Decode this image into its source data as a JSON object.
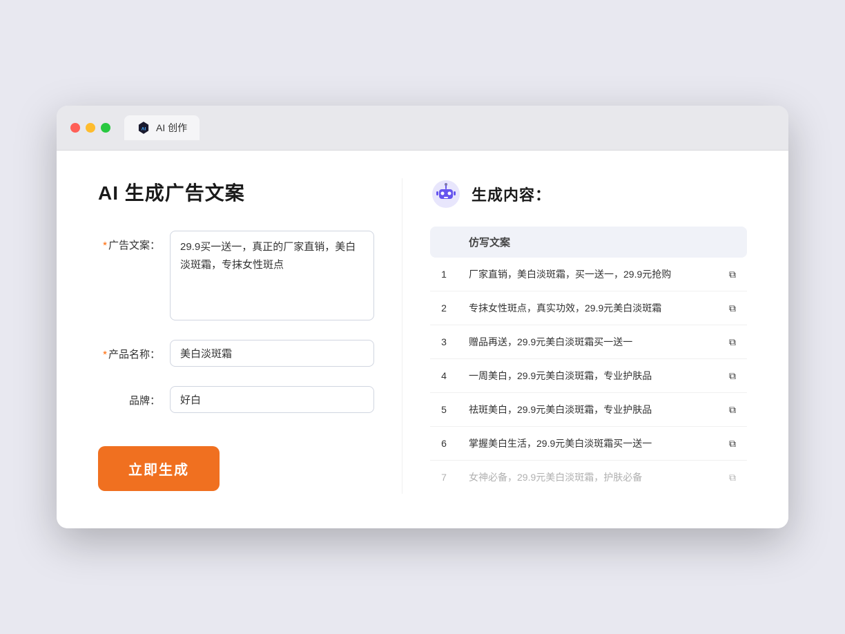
{
  "window": {
    "tab_label": "AI 创作"
  },
  "left": {
    "title": "AI 生成广告文案",
    "fields": [
      {
        "label": "广告文案：",
        "required": true,
        "type": "textarea",
        "value": "29.9买一送一，真正的厂家直销，美白淡斑霜，专抹女性斑点",
        "name": "ad-copy-textarea"
      },
      {
        "label": "产品名称：",
        "required": true,
        "type": "input",
        "value": "美白淡斑霜",
        "name": "product-name-input"
      },
      {
        "label": "品牌：",
        "required": false,
        "type": "input",
        "value": "好白",
        "name": "brand-input"
      }
    ],
    "button_label": "立即生成"
  },
  "right": {
    "title": "生成内容：",
    "table": {
      "header": "仿写文案",
      "rows": [
        {
          "num": "1",
          "text": "厂家直销，美白淡斑霜，买一送一，29.9元抢购",
          "faded": false
        },
        {
          "num": "2",
          "text": "专抹女性斑点，真实功效，29.9元美白淡斑霜",
          "faded": false
        },
        {
          "num": "3",
          "text": "赠品再送，29.9元美白淡斑霜买一送一",
          "faded": false
        },
        {
          "num": "4",
          "text": "一周美白，29.9元美白淡斑霜，专业护肤品",
          "faded": false
        },
        {
          "num": "5",
          "text": "祛斑美白，29.9元美白淡斑霜，专业护肤品",
          "faded": false
        },
        {
          "num": "6",
          "text": "掌握美白生活，29.9元美白淡斑霜买一送一",
          "faded": false
        },
        {
          "num": "7",
          "text": "女神必备，29.9元美白淡斑霜，护肤必备",
          "faded": true
        }
      ]
    }
  }
}
